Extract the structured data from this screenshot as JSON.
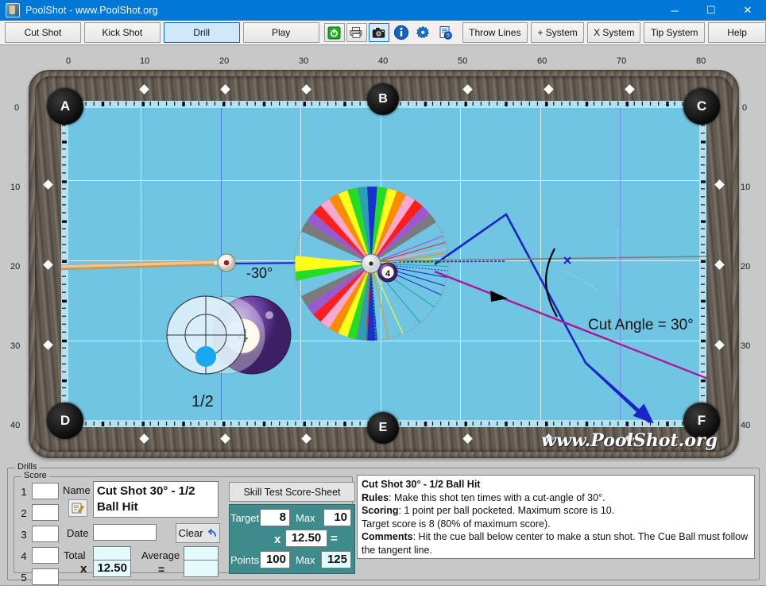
{
  "window": {
    "title": "PoolShot - www.PoolShot.org",
    "icon": "app-icon",
    "minimize": "─",
    "maximize": "☐",
    "close": "✕"
  },
  "toolbar": {
    "tabs": [
      {
        "label": "Cut Shot",
        "active": false
      },
      {
        "label": "Kick Shot",
        "active": false
      },
      {
        "label": "Drill",
        "active": true
      },
      {
        "label": "Play",
        "active": false
      }
    ],
    "icons": [
      {
        "name": "power-icon",
        "glyph": "⏻"
      },
      {
        "name": "printer-icon",
        "glyph": "⎙"
      },
      {
        "name": "camera-icon",
        "glyph": "■"
      },
      {
        "name": "info-icon",
        "glyph": "i"
      },
      {
        "name": "gear-icon",
        "glyph": "⚙"
      },
      {
        "name": "help-document-icon",
        "glyph": "⍰"
      }
    ],
    "right_buttons": [
      {
        "label": "Throw Lines"
      },
      {
        "label": "+ System"
      },
      {
        "label": "X System"
      },
      {
        "label": "Tip System"
      },
      {
        "label": "Help"
      }
    ]
  },
  "table": {
    "ruler_top": [
      "0",
      "10",
      "20",
      "30",
      "40",
      "50",
      "60",
      "70",
      "80"
    ],
    "ruler_left": [
      "0",
      "10",
      "20",
      "30",
      "40"
    ],
    "ruler_right": [
      "0",
      "10",
      "20",
      "30",
      "40"
    ],
    "pockets": [
      "A",
      "B",
      "C",
      "D",
      "E",
      "F"
    ],
    "cut_angle_label": "Cut Angle = 30°",
    "aim_angle_label": "-30°",
    "hit_fraction_label": "1/2",
    "object_ball_number": "4",
    "watermark": "www.PoolShot.org",
    "felt_color": "#6ec4e2",
    "tangent_line_color": "#1a22c8",
    "object_path_color": "#b0149a"
  },
  "drills": {
    "group_label": "Drills",
    "score_group_label": "Score",
    "score_rows": [
      "1",
      "2",
      "3",
      "4",
      "5"
    ],
    "score_values": [
      "",
      "",
      "",
      "",
      ""
    ],
    "name_label": "Name",
    "name_value": "Cut Shot 30° - 1/2 Ball Hit",
    "note_icon": "note-edit-icon",
    "date_label": "Date",
    "date_value": "",
    "clear_label": "Clear",
    "clear_icon": "undo-arrow-icon",
    "total_label": "Total",
    "total_value": "",
    "average_label": "Average",
    "average_value": "",
    "multiply_label": "x",
    "multiplier_value": "12.50",
    "equals_label": "=",
    "result_value": ""
  },
  "scoresheet": {
    "title": "Skill Test Score-Sheet",
    "target_label": "Target",
    "target_value": "8",
    "target_max_label": "Max",
    "target_max_value": "10",
    "multiply_label": "x",
    "multiplier_value": "12.50",
    "equals_label": "=",
    "points_label": "Points",
    "points_value": "100",
    "points_max_label": "Max",
    "points_max_value": "125",
    "panel_color": "#3f8b8b"
  },
  "description": {
    "title": "Cut Shot 30° - 1/2 Ball Hit",
    "rules_label": "Rules",
    "rules_text": ": Make this shot ten times with a cut-angle of 30°.",
    "scoring_label": "Scoring",
    "scoring_text": ": 1 point per ball pocketed. Maximum score is 10.",
    "target_line": "Target score is 8 (80% of maximum score).",
    "comments_label": "Comments",
    "comments_text": ": Hit the cue ball below center to make a stun shot. The Cue Ball must follow the tangent line."
  }
}
